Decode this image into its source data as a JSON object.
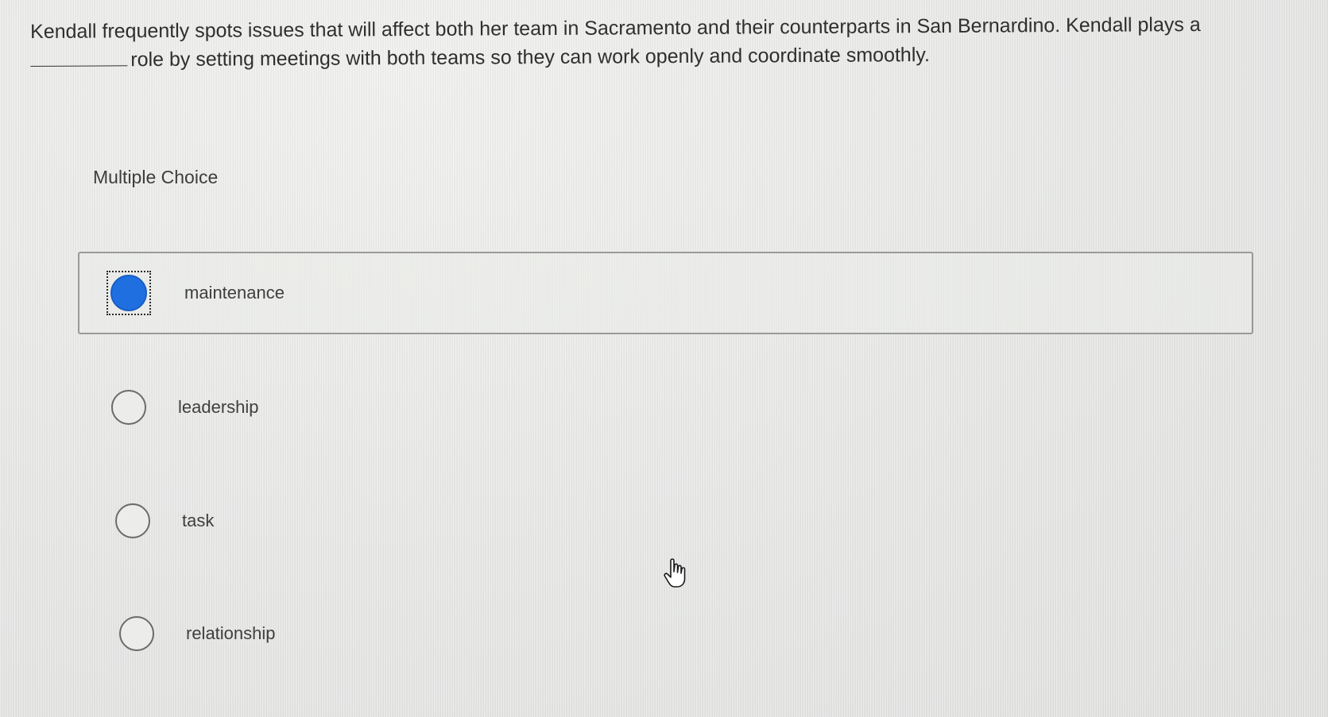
{
  "question": {
    "part1": "Kendall frequently spots issues that will affect both her team in Sacramento and their counterparts in San Bernardino. Kendall plays a",
    "part2": "role by setting meetings with both teams so they can work openly and coordinate smoothly."
  },
  "section_label": "Multiple Choice",
  "options": [
    {
      "label": "maintenance",
      "selected": true
    },
    {
      "label": "leadership",
      "selected": false
    },
    {
      "label": "task",
      "selected": false
    },
    {
      "label": "relationship",
      "selected": false
    }
  ],
  "colors": {
    "selected_radio": "#1f6fe0",
    "background": "#e6e7e6"
  },
  "icons": {
    "cursor": "hand-pointer-icon"
  }
}
